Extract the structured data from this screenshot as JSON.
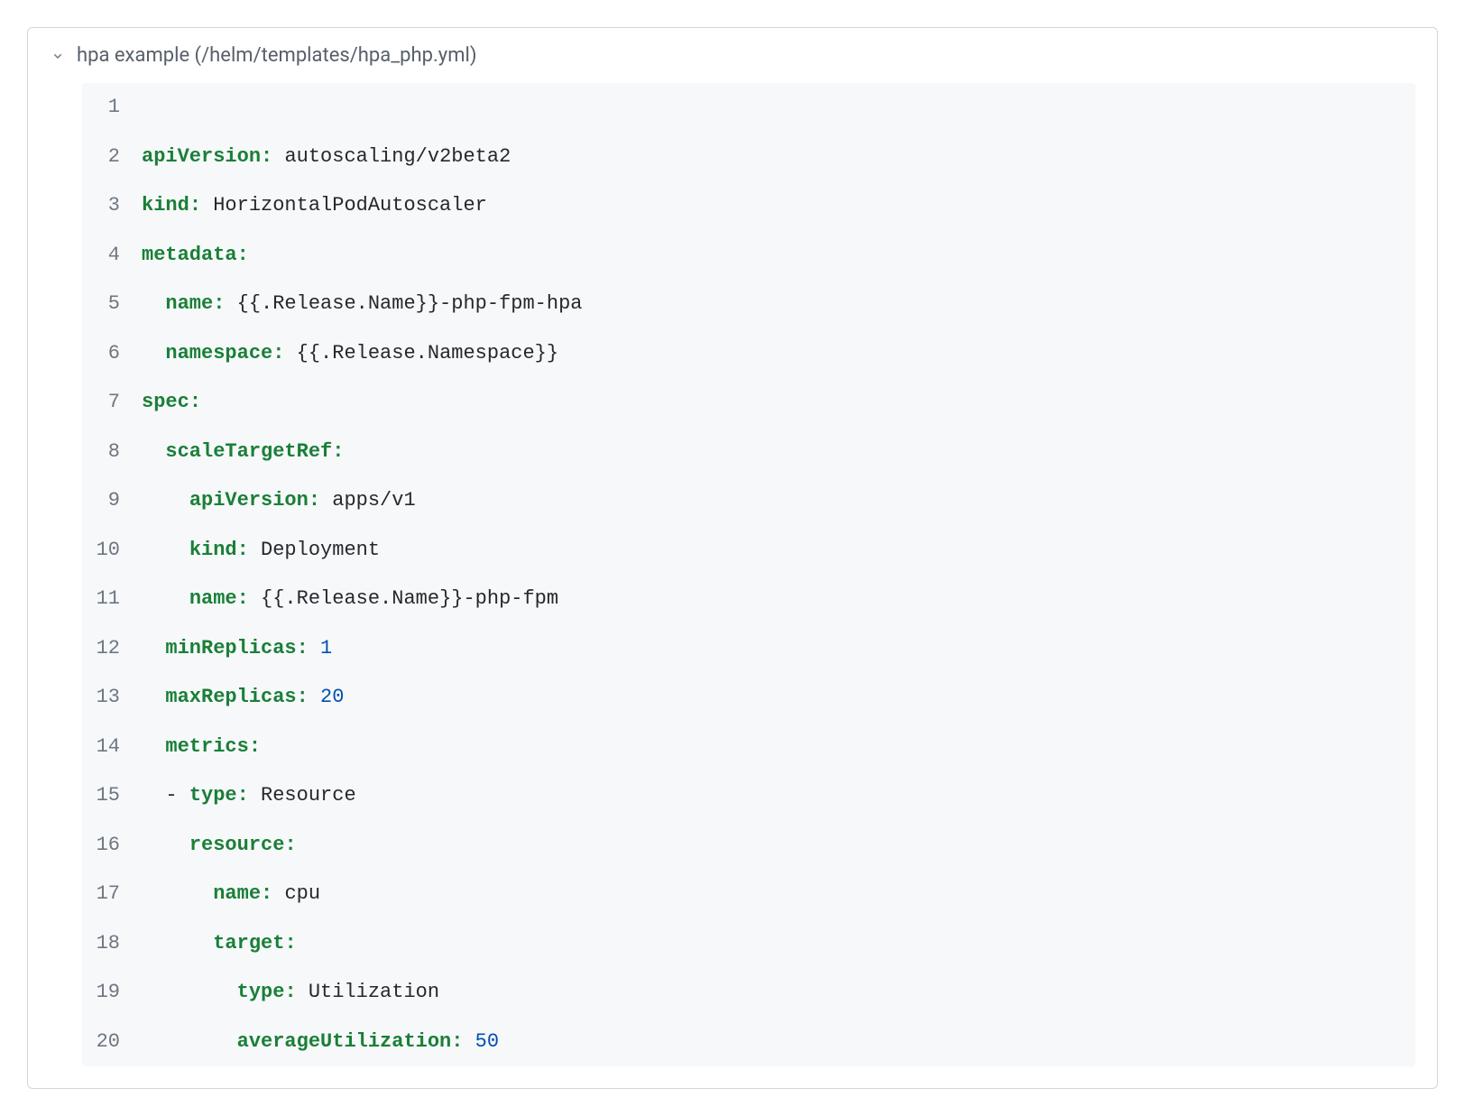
{
  "header": {
    "title": "hpa example (/helm/templates/hpa_php.yml)"
  },
  "code": {
    "lines": [
      {
        "n": "1",
        "segs": []
      },
      {
        "n": "2",
        "segs": [
          {
            "t": "apiVersion",
            "c": "tok-key"
          },
          {
            "t": ":",
            "c": "tok-key"
          },
          {
            "t": " ",
            "c": "tok-val"
          },
          {
            "t": "autoscaling/v2beta2",
            "c": "tok-val"
          }
        ]
      },
      {
        "n": "3",
        "segs": [
          {
            "t": "kind",
            "c": "tok-key"
          },
          {
            "t": ":",
            "c": "tok-key"
          },
          {
            "t": " ",
            "c": "tok-val"
          },
          {
            "t": "HorizontalPodAutoscaler",
            "c": "tok-val"
          }
        ]
      },
      {
        "n": "4",
        "segs": [
          {
            "t": "metadata",
            "c": "tok-key"
          },
          {
            "t": ":",
            "c": "tok-key"
          }
        ]
      },
      {
        "n": "5",
        "segs": [
          {
            "t": "  ",
            "c": "tok-val"
          },
          {
            "t": "name",
            "c": "tok-key"
          },
          {
            "t": ":",
            "c": "tok-key"
          },
          {
            "t": " ",
            "c": "tok-val"
          },
          {
            "t": "{{.Release.Name}}-php-fpm-hpa",
            "c": "tok-val"
          }
        ]
      },
      {
        "n": "6",
        "segs": [
          {
            "t": "  ",
            "c": "tok-val"
          },
          {
            "t": "namespace",
            "c": "tok-key"
          },
          {
            "t": ":",
            "c": "tok-key"
          },
          {
            "t": " ",
            "c": "tok-val"
          },
          {
            "t": "{{.Release.Namespace}}",
            "c": "tok-val"
          }
        ]
      },
      {
        "n": "7",
        "segs": [
          {
            "t": "spec",
            "c": "tok-key"
          },
          {
            "t": ":",
            "c": "tok-key"
          }
        ]
      },
      {
        "n": "8",
        "segs": [
          {
            "t": "  ",
            "c": "tok-val"
          },
          {
            "t": "scaleTargetRef",
            "c": "tok-key"
          },
          {
            "t": ":",
            "c": "tok-key"
          }
        ]
      },
      {
        "n": "9",
        "segs": [
          {
            "t": "    ",
            "c": "tok-val"
          },
          {
            "t": "apiVersion",
            "c": "tok-key"
          },
          {
            "t": ":",
            "c": "tok-key"
          },
          {
            "t": " ",
            "c": "tok-val"
          },
          {
            "t": "apps/v1",
            "c": "tok-val"
          }
        ]
      },
      {
        "n": "10",
        "segs": [
          {
            "t": "    ",
            "c": "tok-val"
          },
          {
            "t": "kind",
            "c": "tok-key"
          },
          {
            "t": ":",
            "c": "tok-key"
          },
          {
            "t": " ",
            "c": "tok-val"
          },
          {
            "t": "Deployment",
            "c": "tok-val"
          }
        ]
      },
      {
        "n": "11",
        "segs": [
          {
            "t": "    ",
            "c": "tok-val"
          },
          {
            "t": "name",
            "c": "tok-key"
          },
          {
            "t": ":",
            "c": "tok-key"
          },
          {
            "t": " ",
            "c": "tok-val"
          },
          {
            "t": "{{.Release.Name}}-php-fpm",
            "c": "tok-val"
          }
        ]
      },
      {
        "n": "12",
        "segs": [
          {
            "t": "  ",
            "c": "tok-val"
          },
          {
            "t": "minReplicas",
            "c": "tok-key"
          },
          {
            "t": ":",
            "c": "tok-key"
          },
          {
            "t": " ",
            "c": "tok-val"
          },
          {
            "t": "1",
            "c": "tok-num"
          }
        ]
      },
      {
        "n": "13",
        "segs": [
          {
            "t": "  ",
            "c": "tok-val"
          },
          {
            "t": "maxReplicas",
            "c": "tok-key"
          },
          {
            "t": ":",
            "c": "tok-key"
          },
          {
            "t": " ",
            "c": "tok-val"
          },
          {
            "t": "20",
            "c": "tok-num"
          }
        ]
      },
      {
        "n": "14",
        "segs": [
          {
            "t": "  ",
            "c": "tok-val"
          },
          {
            "t": "metrics",
            "c": "tok-key"
          },
          {
            "t": ":",
            "c": "tok-key"
          }
        ]
      },
      {
        "n": "15",
        "segs": [
          {
            "t": "  ",
            "c": "tok-val"
          },
          {
            "t": "- ",
            "c": "tok-dash"
          },
          {
            "t": "type",
            "c": "tok-key"
          },
          {
            "t": ":",
            "c": "tok-key"
          },
          {
            "t": " ",
            "c": "tok-val"
          },
          {
            "t": "Resource",
            "c": "tok-val"
          }
        ]
      },
      {
        "n": "16",
        "segs": [
          {
            "t": "    ",
            "c": "tok-val"
          },
          {
            "t": "resource",
            "c": "tok-key"
          },
          {
            "t": ":",
            "c": "tok-key"
          }
        ]
      },
      {
        "n": "17",
        "segs": [
          {
            "t": "      ",
            "c": "tok-val"
          },
          {
            "t": "name",
            "c": "tok-key"
          },
          {
            "t": ":",
            "c": "tok-key"
          },
          {
            "t": " ",
            "c": "tok-val"
          },
          {
            "t": "cpu",
            "c": "tok-val"
          }
        ]
      },
      {
        "n": "18",
        "segs": [
          {
            "t": "      ",
            "c": "tok-val"
          },
          {
            "t": "target",
            "c": "tok-key"
          },
          {
            "t": ":",
            "c": "tok-key"
          }
        ]
      },
      {
        "n": "19",
        "segs": [
          {
            "t": "        ",
            "c": "tok-val"
          },
          {
            "t": "type",
            "c": "tok-key"
          },
          {
            "t": ":",
            "c": "tok-key"
          },
          {
            "t": " ",
            "c": "tok-val"
          },
          {
            "t": "Utilization",
            "c": "tok-val"
          }
        ]
      },
      {
        "n": "20",
        "segs": [
          {
            "t": "        ",
            "c": "tok-val"
          },
          {
            "t": "averageUtilization",
            "c": "tok-key"
          },
          {
            "t": ":",
            "c": "tok-key"
          },
          {
            "t": " ",
            "c": "tok-val"
          },
          {
            "t": "50",
            "c": "tok-num"
          }
        ]
      }
    ]
  }
}
